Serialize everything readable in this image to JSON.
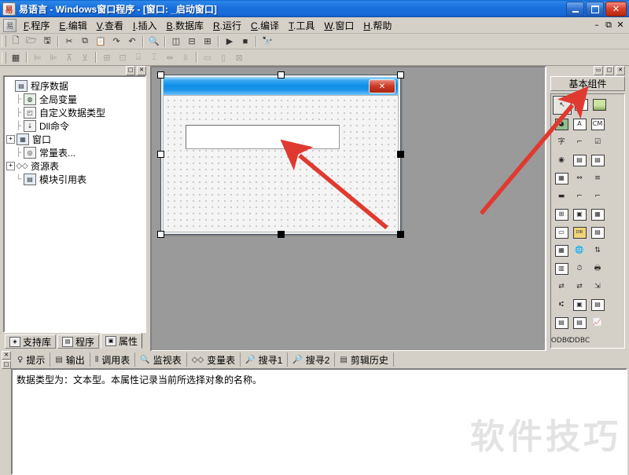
{
  "window": {
    "title": "易语言 - Windows窗口程序 - [窗口: _启动窗口]",
    "icon": "app-icon",
    "minimize": "–",
    "maximize": "□",
    "close": "✕"
  },
  "menubar": {
    "icon": "document-icon",
    "items": [
      {
        "acc": "F",
        "label": ".程序"
      },
      {
        "acc": "E",
        "label": ".编辑"
      },
      {
        "acc": "V",
        "label": ".查看"
      },
      {
        "acc": "I",
        "label": ".插入"
      },
      {
        "acc": "B",
        "label": ".数据库"
      },
      {
        "acc": "R",
        "label": ".运行"
      },
      {
        "acc": "C",
        "label": ".编译"
      },
      {
        "acc": "T",
        "label": ".工具"
      },
      {
        "acc": "W",
        "label": ".窗口"
      },
      {
        "acc": "H",
        "label": ".帮助"
      }
    ],
    "mdi": [
      "–",
      "⧉",
      "✕"
    ]
  },
  "toolbar_main": [
    {
      "name": "new-file-button",
      "glyph": "🗋"
    },
    {
      "name": "open-file-button",
      "glyph": "🗁"
    },
    {
      "name": "save-file-button",
      "glyph": "🖫"
    },
    {
      "name": "sep1",
      "glyph": "|"
    },
    {
      "name": "cut-button",
      "glyph": "✂"
    },
    {
      "name": "copy-button",
      "glyph": "⧉"
    },
    {
      "name": "paste-button",
      "glyph": "📋"
    },
    {
      "name": "redo-button",
      "glyph": "↷"
    },
    {
      "name": "undo-button",
      "glyph": "↶"
    },
    {
      "name": "sep2",
      "glyph": "|"
    },
    {
      "name": "find-button",
      "glyph": "🔍"
    },
    {
      "name": "sep3",
      "glyph": "|"
    },
    {
      "name": "layout-left-button",
      "glyph": "◫"
    },
    {
      "name": "layout-split-button",
      "glyph": "⊟"
    },
    {
      "name": "layout-grid-button",
      "glyph": "⊞"
    },
    {
      "name": "sep4",
      "glyph": "|"
    },
    {
      "name": "run-button",
      "glyph": "▶"
    },
    {
      "name": "stop-button",
      "glyph": "■"
    },
    {
      "name": "sep5",
      "glyph": "|"
    },
    {
      "name": "find-next-button",
      "glyph": "🔭"
    }
  ],
  "toolbar_align": [
    {
      "name": "properties-button",
      "glyph": "▦"
    },
    {
      "name": "sep1",
      "glyph": "|"
    },
    {
      "name": "align-left-button",
      "glyph": "⊨"
    },
    {
      "name": "align-right-button",
      "glyph": "⊭"
    },
    {
      "name": "align-top-button",
      "glyph": "⊼"
    },
    {
      "name": "align-bottom-button",
      "glyph": "⊻"
    },
    {
      "name": "sep2",
      "glyph": "|"
    },
    {
      "name": "center-horizontal-button",
      "glyph": "⊞"
    },
    {
      "name": "center-vertical-button",
      "glyph": "⊡"
    },
    {
      "name": "same-width-button",
      "glyph": "⌸"
    },
    {
      "name": "same-height-button",
      "glyph": "⌹"
    },
    {
      "name": "space-horizontal-button",
      "glyph": "⇹"
    },
    {
      "name": "space-vertical-button",
      "glyph": "⇳"
    },
    {
      "name": "sep3",
      "glyph": "|"
    },
    {
      "name": "size-width-button",
      "glyph": "▭"
    },
    {
      "name": "size-height-button",
      "glyph": "▯"
    },
    {
      "name": "size-both-button",
      "glyph": "⊠"
    }
  ],
  "left_panel": {
    "caption_buttons": [
      "□",
      "✕"
    ],
    "tree": [
      {
        "expander": "",
        "icon": "program-data-icon",
        "iconglyph": "▤",
        "label": "程序数据",
        "level": 0,
        "iconclass": "b"
      },
      {
        "expander": "",
        "icon": "global-variable-icon",
        "iconglyph": "◍",
        "label": "全局变量",
        "level": 1,
        "iconclass": "g"
      },
      {
        "expander": "",
        "icon": "custom-datatype-icon",
        "iconglyph": "◰",
        "label": "自定义数据类型",
        "level": 1,
        "iconclass": ""
      },
      {
        "expander": "",
        "icon": "dll-command-icon",
        "iconglyph": "↓",
        "label": "Dll命令",
        "level": 1,
        "iconclass": ""
      },
      {
        "expander": "+",
        "icon": "window-icon",
        "iconglyph": "▦",
        "label": "窗口",
        "level": 1,
        "iconclass": "b"
      },
      {
        "expander": "",
        "icon": "constant-table-icon",
        "iconglyph": "◎",
        "label": "常量表...",
        "level": 1,
        "iconclass": ""
      },
      {
        "expander": "+",
        "icon": "resource-table-icon",
        "iconglyph": "◇",
        "label": "资源表",
        "level": 1,
        "iconclass": "ns"
      },
      {
        "expander": "",
        "icon": "module-reference-icon",
        "iconglyph": "▤",
        "label": "模块引用表",
        "level": 1,
        "iconclass": "b"
      }
    ],
    "tabs": [
      {
        "icon": "library-icon",
        "iconglyph": "◈",
        "label": "支持库",
        "active": false
      },
      {
        "icon": "program-icon",
        "iconglyph": "▤",
        "label": "程序",
        "active": false
      },
      {
        "icon": "properties-icon",
        "iconglyph": "▣",
        "label": "属性",
        "active": true
      }
    ]
  },
  "designer": {
    "form_close_label": "✕",
    "form_title": "",
    "edit_value": ""
  },
  "right_panel": {
    "caption_buttons": [
      "▭",
      "□",
      "✕"
    ],
    "header": "基本组件",
    "components": [
      {
        "name": "pointer-tool",
        "glyph": "↖",
        "selected": true,
        "style": "plain"
      },
      {
        "name": "edit-box-tool",
        "glyph": "AI",
        "style": "box"
      },
      {
        "name": "picture-box-tool",
        "glyph": "",
        "style": "img"
      },
      {
        "name": "shape-tool",
        "glyph": "◕",
        "style": "green"
      },
      {
        "name": "label-tool",
        "glyph": "A",
        "style": "box"
      },
      {
        "name": "button-tool",
        "glyph": "CM",
        "style": "box"
      },
      {
        "name": "text-tool",
        "glyph": "字",
        "style": "plain"
      },
      {
        "name": "frame-tool",
        "glyph": "⌐",
        "style": "plain"
      },
      {
        "name": "check-box-tool",
        "glyph": "☑",
        "style": "plain"
      },
      {
        "name": "radio-button-tool",
        "glyph": "◉",
        "style": "plain"
      },
      {
        "name": "list-box-tool",
        "glyph": "▤",
        "style": "box"
      },
      {
        "name": "combo-box-tool",
        "glyph": "▤",
        "style": "box"
      },
      {
        "name": "grid-tool",
        "glyph": "▦",
        "style": "box"
      },
      {
        "name": "scroll-bar-tool",
        "glyph": "⇔",
        "style": "plain"
      },
      {
        "name": "vertical-bar-tool",
        "glyph": "≡",
        "style": "plain"
      },
      {
        "name": "progress-bar-tool",
        "glyph": "▬",
        "style": "plain"
      },
      {
        "name": "slider-tool",
        "glyph": "⌐",
        "style": "plain"
      },
      {
        "name": "group-box-tool",
        "glyph": "⌐",
        "style": "plain"
      },
      {
        "name": "tree-view-tool",
        "glyph": "⊞",
        "style": "box"
      },
      {
        "name": "image-list-tool",
        "glyph": "▣",
        "style": "box"
      },
      {
        "name": "calendar-tool",
        "glyph": "▦",
        "style": "box"
      },
      {
        "name": "label-frame-tool",
        "glyph": "▭",
        "style": "box"
      },
      {
        "name": "folder-tool",
        "glyph": "DIR",
        "style": "yellow"
      },
      {
        "name": "file-list-tool",
        "glyph": "▤",
        "style": "box"
      },
      {
        "name": "date-picker-tool",
        "glyph": "▦",
        "style": "box"
      },
      {
        "name": "internet-tool",
        "glyph": "🌐",
        "style": "plain"
      },
      {
        "name": "spin-tool",
        "glyph": "⇅",
        "style": "plain"
      },
      {
        "name": "table-tool",
        "glyph": "▥",
        "style": "box"
      },
      {
        "name": "timer-tool",
        "glyph": "⏱",
        "style": "plain"
      },
      {
        "name": "printer-tool",
        "glyph": "🖶",
        "style": "plain"
      },
      {
        "name": "link-send-tool",
        "glyph": "⇄",
        "style": "plain"
      },
      {
        "name": "link-recv-tool",
        "glyph": "⇄",
        "style": "plain"
      },
      {
        "name": "client-tool",
        "glyph": "⇲",
        "style": "plain"
      },
      {
        "name": "network-tool",
        "glyph": "⑆",
        "style": "plain"
      },
      {
        "name": "picture-frame-tool",
        "glyph": "▣",
        "style": "box"
      },
      {
        "name": "splitter-tool",
        "glyph": "▤",
        "style": "box"
      },
      {
        "name": "database-tool",
        "glyph": "▤",
        "style": "box"
      },
      {
        "name": "record-set-tool",
        "glyph": "▤",
        "style": "box"
      },
      {
        "name": "chart-tool",
        "glyph": "📈",
        "style": "plain"
      },
      {
        "name": "odbc-tool",
        "glyph": "ODBC",
        "style": "plain"
      },
      {
        "name": "odbc-source-tool",
        "glyph": "ODBC",
        "style": "plain"
      }
    ]
  },
  "bottom_panel": {
    "close_buttons": [
      "✕",
      "□"
    ],
    "tabs": [
      {
        "icon": "hint-icon",
        "iconglyph": "♀",
        "label": "提示",
        "active": true
      },
      {
        "icon": "output-icon",
        "iconglyph": "▤",
        "label": "输出",
        "active": false
      },
      {
        "icon": "call-table-icon",
        "iconglyph": "⋮⋮",
        "label": "调用表",
        "active": false
      },
      {
        "icon": "watch-table-icon",
        "iconglyph": "🔍",
        "label": "监视表",
        "active": false
      },
      {
        "icon": "variable-table-icon",
        "iconglyph": "◇◇",
        "label": "变量表",
        "active": false
      },
      {
        "icon": "search1-icon",
        "iconglyph": "🔎",
        "label": "搜寻1",
        "active": false
      },
      {
        "icon": "search2-icon",
        "iconglyph": "🔎",
        "label": "搜寻2",
        "active": false
      },
      {
        "icon": "clip-history-icon",
        "iconglyph": "▤",
        "label": "剪辑历史",
        "active": false
      }
    ],
    "status_text": "数据类型为：文本型。本属性记录当前所选择对象的名称。",
    "watermark": "软件技巧"
  },
  "colors": {
    "title_blue": "#1a72de",
    "chrome_gray": "#d4d0c8",
    "designer_gray": "#9a9a9a",
    "form_title_blue": "#0f8fe8",
    "close_red": "#cf3c26",
    "arrow_red": "#e03a30",
    "watermark_gray": "#e3e3e3"
  }
}
